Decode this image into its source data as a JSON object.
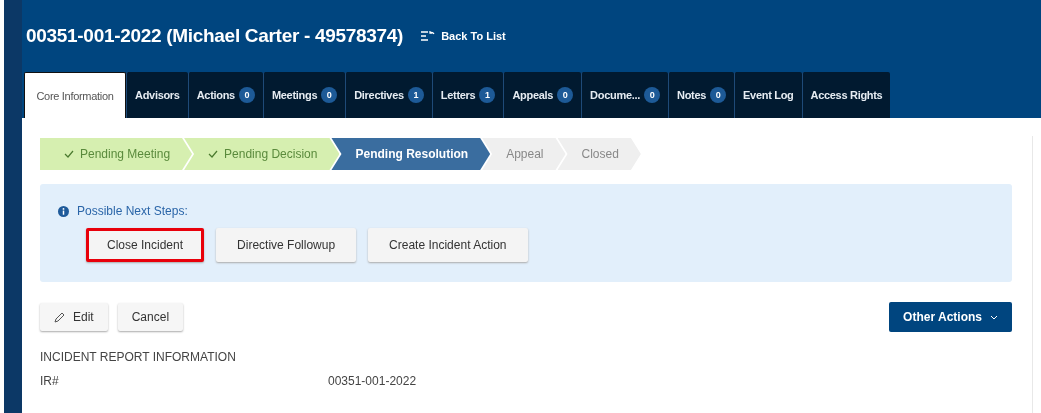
{
  "header": {
    "title": "00351-001-2022 (Michael Carter - 49578374)",
    "back_link": "Back To List"
  },
  "tabs": [
    {
      "label": "Core Information",
      "selected": true
    },
    {
      "label": "Advisors",
      "selected": false
    },
    {
      "label": "Actions",
      "count": "0",
      "selected": false
    },
    {
      "label": "Meetings",
      "count": "0",
      "selected": false
    },
    {
      "label": "Directives",
      "count": "1",
      "selected": false
    },
    {
      "label": "Letters",
      "count": "1",
      "selected": false
    },
    {
      "label": "Appeals",
      "count": "0",
      "selected": false
    },
    {
      "label": "Docume...",
      "count": "0",
      "selected": false
    },
    {
      "label": "Notes",
      "count": "0",
      "selected": false
    },
    {
      "label": "Event Log",
      "selected": false
    },
    {
      "label": "Access Rights",
      "selected": false
    }
  ],
  "stages": [
    {
      "label": "Pending Meeting",
      "kind": "done"
    },
    {
      "label": "Pending Decision",
      "kind": "done"
    },
    {
      "label": "Pending Resolution",
      "kind": "current"
    },
    {
      "label": "Appeal",
      "kind": "pending"
    },
    {
      "label": "Closed",
      "kind": "pending"
    }
  ],
  "next_steps": {
    "label": "Possible Next Steps:",
    "buttons": [
      {
        "label": "Close Incident",
        "highlighted": true
      },
      {
        "label": "Directive Followup",
        "highlighted": false
      },
      {
        "label": "Create Incident Action",
        "highlighted": false
      }
    ]
  },
  "actions": {
    "edit": "Edit",
    "cancel": "Cancel",
    "other": "Other Actions"
  },
  "section": {
    "title": "INCIDENT REPORT INFORMATION",
    "fields": [
      {
        "label": "IR#",
        "value": "00351-001-2022"
      }
    ]
  }
}
